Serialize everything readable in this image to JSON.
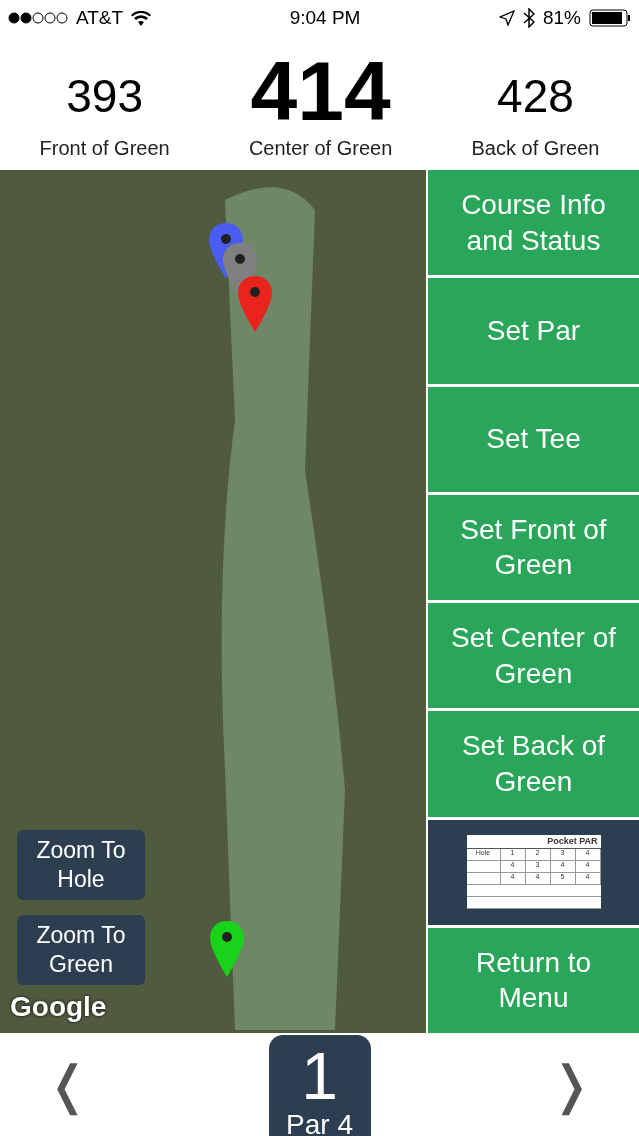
{
  "status_bar": {
    "carrier": "AT&T",
    "time": "9:04 PM",
    "battery": "81%"
  },
  "distances": [
    {
      "value": "393",
      "label": "Front of Green",
      "kind": "side"
    },
    {
      "value": "414",
      "label": "Center of Green",
      "kind": "main"
    },
    {
      "value": "428",
      "label": "Back of Green",
      "kind": "side"
    }
  ],
  "map": {
    "attribution": "Google",
    "pins": [
      {
        "color": "#4a5df0"
      },
      {
        "color": "#808080"
      },
      {
        "color": "#e8241c"
      },
      {
        "color": "#19d31b"
      }
    ],
    "buttons": [
      "Zoom To Hole",
      "Zoom To Green"
    ]
  },
  "actions": [
    {
      "kind": "text",
      "label": "Course Info and Status"
    },
    {
      "kind": "text",
      "label": "Set Par"
    },
    {
      "kind": "text",
      "label": "Set Tee"
    },
    {
      "kind": "text",
      "label": "Set Front of Green"
    },
    {
      "kind": "text",
      "label": "Set Center of Green"
    },
    {
      "kind": "text",
      "label": "Set Back of Green"
    },
    {
      "kind": "scorecard",
      "title": "Pocket PAR",
      "header": [
        "Hole",
        "1",
        "2",
        "3",
        "4"
      ],
      "rows": [
        [
          "4",
          "3",
          "4",
          "4"
        ],
        [
          "4",
          "4",
          "5",
          "4"
        ]
      ]
    },
    {
      "kind": "text",
      "label": "Return to Menu"
    }
  ],
  "hole": {
    "prev": "❬",
    "next": "❭",
    "number": "1",
    "par": "Par 4"
  }
}
